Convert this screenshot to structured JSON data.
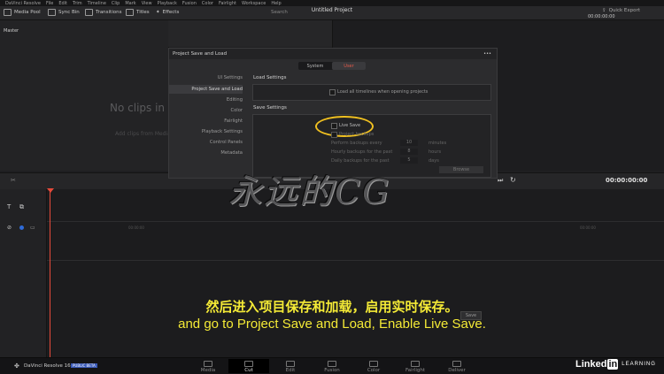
{
  "app": {
    "title": "DaVinci Resolve",
    "project_title": "Untitled Project"
  },
  "menu": [
    "Edit",
    "File",
    "Trim",
    "Timeline",
    "Clip",
    "Mark",
    "View",
    "Playback",
    "Fusion",
    "Color",
    "Fairlight",
    "Workspace",
    "Help"
  ],
  "toolbar": {
    "media_pool": "Media Pool",
    "sync_bin": "Sync Bin",
    "transitions": "Transitions",
    "titles": "Titles",
    "effects": "Effects",
    "search": "Search",
    "quick_export": "Quick Export",
    "timecode_top": "00:00:00:00"
  },
  "left_pane": {
    "label": "Master",
    "empty_title": "No clips in m",
    "empty_hint": "Add clips from Media"
  },
  "dialog": {
    "title": "Project Save and Load",
    "menu_dots": "•••",
    "tabs": [
      {
        "label": "System",
        "active": false
      },
      {
        "label": "User",
        "active": true
      }
    ],
    "sidebar": [
      {
        "label": "UI Settings",
        "selected": false
      },
      {
        "label": "Project Save and Load",
        "selected": true
      },
      {
        "label": "Editing",
        "selected": false
      },
      {
        "label": "Color",
        "selected": false
      },
      {
        "label": "Fairlight",
        "selected": false
      },
      {
        "label": "Playback Settings",
        "selected": false
      },
      {
        "label": "Control Panels",
        "selected": false
      },
      {
        "label": "Metadata",
        "selected": false
      }
    ],
    "load_settings": {
      "heading": "Load Settings",
      "option": "Load all timelines when opening projects"
    },
    "save_settings": {
      "heading": "Save Settings",
      "live_save": "Live Save",
      "backups": "Project backups",
      "every_label": "Perform backups every",
      "every_value": "10",
      "every_unit": "minutes",
      "hourly_label": "Hourly backups for the past",
      "hourly_value": "8",
      "hourly_unit": "hours",
      "daily_label": "Daily backups for the past",
      "daily_value": "5",
      "daily_unit": "days",
      "browse": "Browse",
      "save_btn": "Save"
    }
  },
  "timeline": {
    "timecode": "00:00:00:00",
    "ruler_mark": "00:00:00",
    "ruler_mark2": "00:00:00"
  },
  "pages": [
    {
      "label": "Media",
      "selected": false
    },
    {
      "label": "Cut",
      "selected": true
    },
    {
      "label": "Edit",
      "selected": false
    },
    {
      "label": "Fusion",
      "selected": false
    },
    {
      "label": "Color",
      "selected": false
    },
    {
      "label": "Fairlight",
      "selected": false
    },
    {
      "label": "Deliver",
      "selected": false
    }
  ],
  "bottom": {
    "product": "DaVinci Resolve 16",
    "badge": "PUBLIC BETA",
    "linkedin_a": "Linked",
    "linkedin_b": "in",
    "learning": "LEARNING"
  },
  "subtitles": {
    "cn": "然后进入项目保存和加载，启用实时保存。",
    "en": "and go to Project Save and Load, Enable Live Save."
  },
  "watermark": "永远的CG",
  "colors": {
    "accent": "#e35a4a",
    "highlight_circle": "#f0c020",
    "subtitle": "#f4ea36",
    "playhead": "#e64a3a"
  }
}
